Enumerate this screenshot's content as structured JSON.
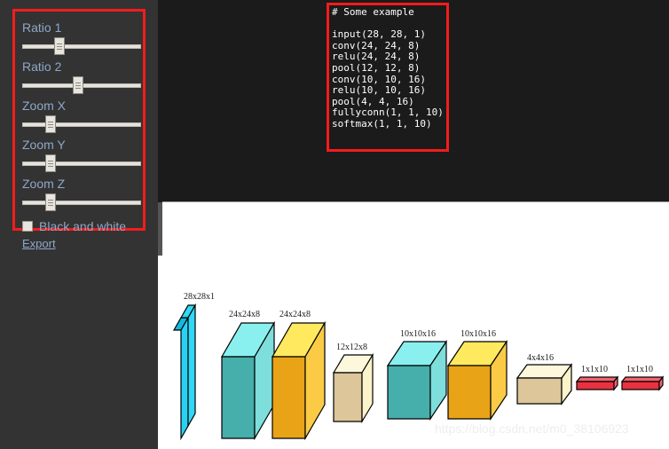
{
  "sidebar": {
    "controls": [
      {
        "name": "ratio-1",
        "label": "Ratio 1",
        "value": 30
      },
      {
        "name": "ratio-2",
        "label": "Ratio 2",
        "value": 47
      },
      {
        "name": "zoom-x",
        "label": "Zoom X",
        "value": 22
      },
      {
        "name": "zoom-y",
        "label": "Zoom Y",
        "value": 22
      },
      {
        "name": "zoom-z",
        "label": "Zoom Z",
        "value": 22
      }
    ],
    "checkbox": {
      "label": "Black and white",
      "checked": false
    },
    "export_label": "Export"
  },
  "code": {
    "lines": [
      "# Some example",
      "",
      "input(28, 28, 1)",
      "conv(24, 24, 8)",
      "relu(24, 24, 8)",
      "pool(12, 12, 8)",
      "conv(10, 10, 16)",
      "relu(10, 10, 16)",
      "pool(4, 4, 16)",
      "fullyconn(1, 1, 10)",
      "softmax(1, 1, 10)"
    ]
  },
  "canvas": {
    "watermark": "https://blog.csdn.net/m0_38106923",
    "layers": [
      {
        "name": "input",
        "label": "28x28x1",
        "top_color": "#2fd8f5",
        "front_color": "#29d2f2",
        "side_color": "#15b7dd"
      },
      {
        "name": "conv-1",
        "label": "24x24x8",
        "top_color": "#8af0ef",
        "front_color": "#46aeab",
        "side_color": "#7ddedb"
      },
      {
        "name": "relu-1",
        "label": "24x24x8",
        "top_color": "#ffe95e",
        "front_color": "#e8a416",
        "side_color": "#fbcb45"
      },
      {
        "name": "pool-1",
        "label": "12x12x8",
        "top_color": "#fdf8dc",
        "front_color": "#dcc69a",
        "side_color": "#fbf3c9"
      },
      {
        "name": "conv-2",
        "label": "10x10x16",
        "top_color": "#8af0ef",
        "front_color": "#46aeab",
        "side_color": "#7ddedb"
      },
      {
        "name": "relu-2",
        "label": "10x10x16",
        "top_color": "#ffe95e",
        "front_color": "#e8a416",
        "side_color": "#fbcb45"
      },
      {
        "name": "pool-2",
        "label": "4x4x16",
        "top_color": "#fdf8dc",
        "front_color": "#dcc69a",
        "side_color": "#fbf3c9"
      },
      {
        "name": "fullyconn",
        "label": "1x1x10",
        "top_color": "#f4626f",
        "front_color": "#e8323f",
        "side_color": "#f4626f"
      },
      {
        "name": "softmax",
        "label": "1x1x10",
        "top_color": "#f4626f",
        "front_color": "#e8323f",
        "side_color": "#f4626f"
      }
    ]
  },
  "colors": {
    "sidebar_bg": "#333333",
    "code_bg": "#1b1b1b",
    "highlight_border": "#f41c1c",
    "label_text": "#8fa8c8"
  }
}
